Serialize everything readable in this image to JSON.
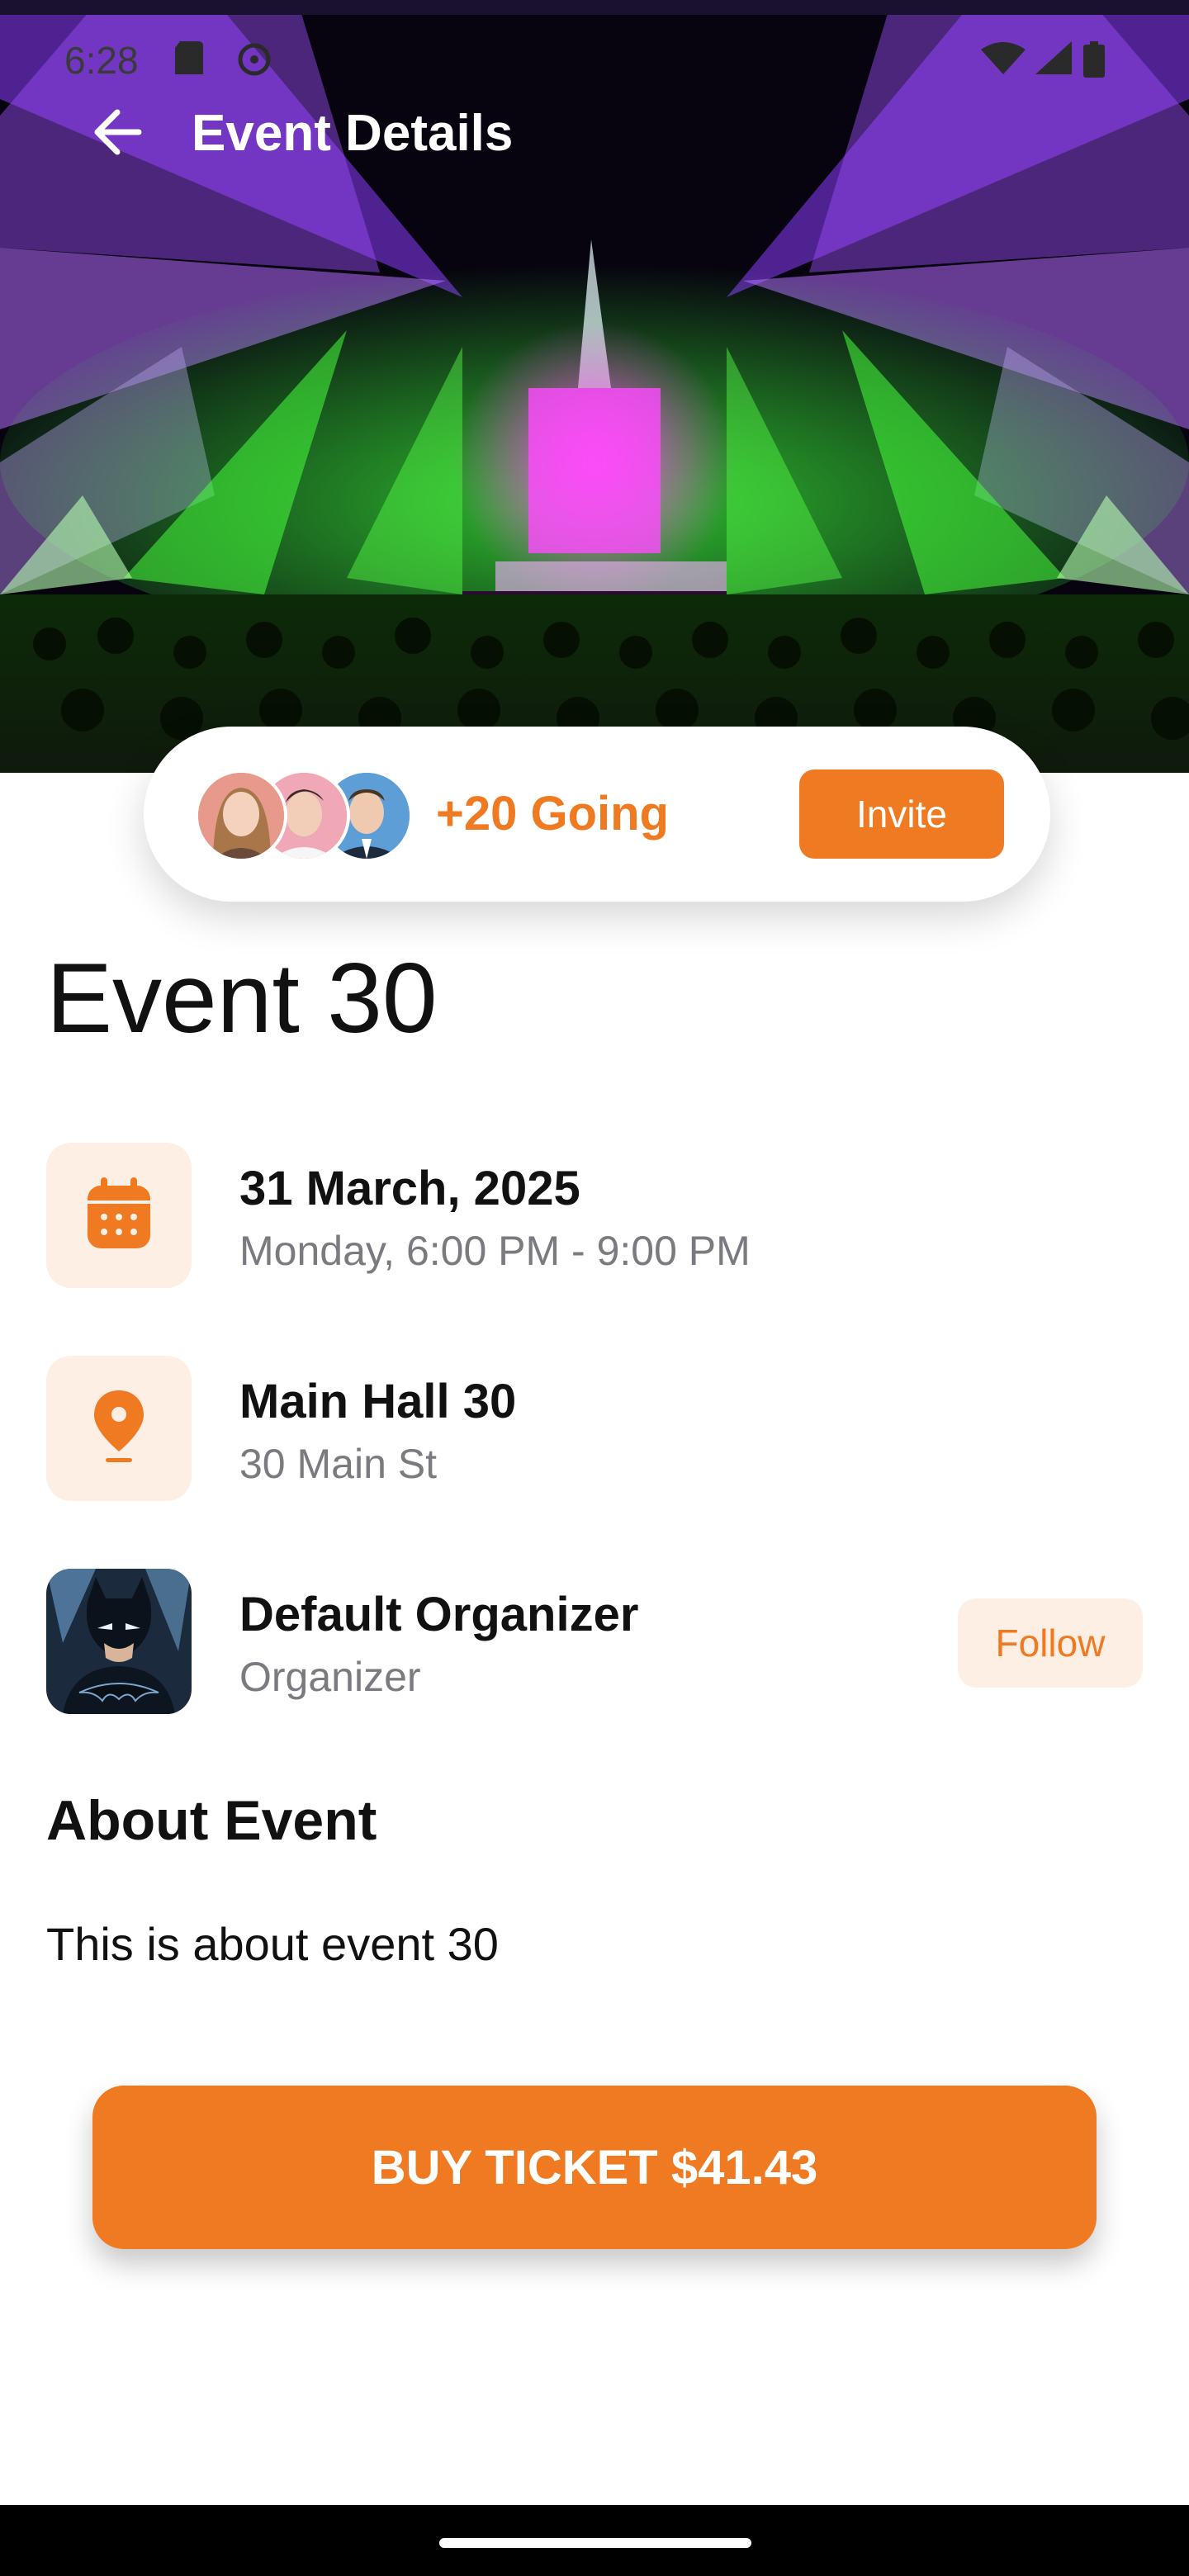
{
  "status_bar": {
    "time": "6:28",
    "icons": [
      "sd-card-icon",
      "sync-icon",
      "wifi-icon",
      "signal-icon",
      "battery-icon"
    ]
  },
  "appbar": {
    "title": "Event Details",
    "back_icon": "arrow-left-icon"
  },
  "going": {
    "label": "+20 Going",
    "invite_label": "Invite",
    "avatars": [
      "avatar-woman",
      "avatar-man-pink",
      "avatar-man-blue"
    ]
  },
  "event": {
    "title": "Event 30",
    "date": {
      "main": "31 March, 2025",
      "sub": "Monday, 6:00 PM - 9:00 PM",
      "icon": "calendar-icon"
    },
    "location": {
      "main": "Main Hall 30",
      "sub": "30 Main St",
      "icon": "location-pin-icon"
    },
    "organizer": {
      "name": "Default Organizer",
      "role": "Organizer",
      "follow_label": "Follow"
    }
  },
  "about": {
    "title": "About Event",
    "text": "This is about event 30"
  },
  "buy": {
    "label": "BUY TICKET $41.43"
  },
  "colors": {
    "accent": "#f07a22",
    "accent_soft": "#fdefe4",
    "muted_text": "#7a7a80"
  }
}
